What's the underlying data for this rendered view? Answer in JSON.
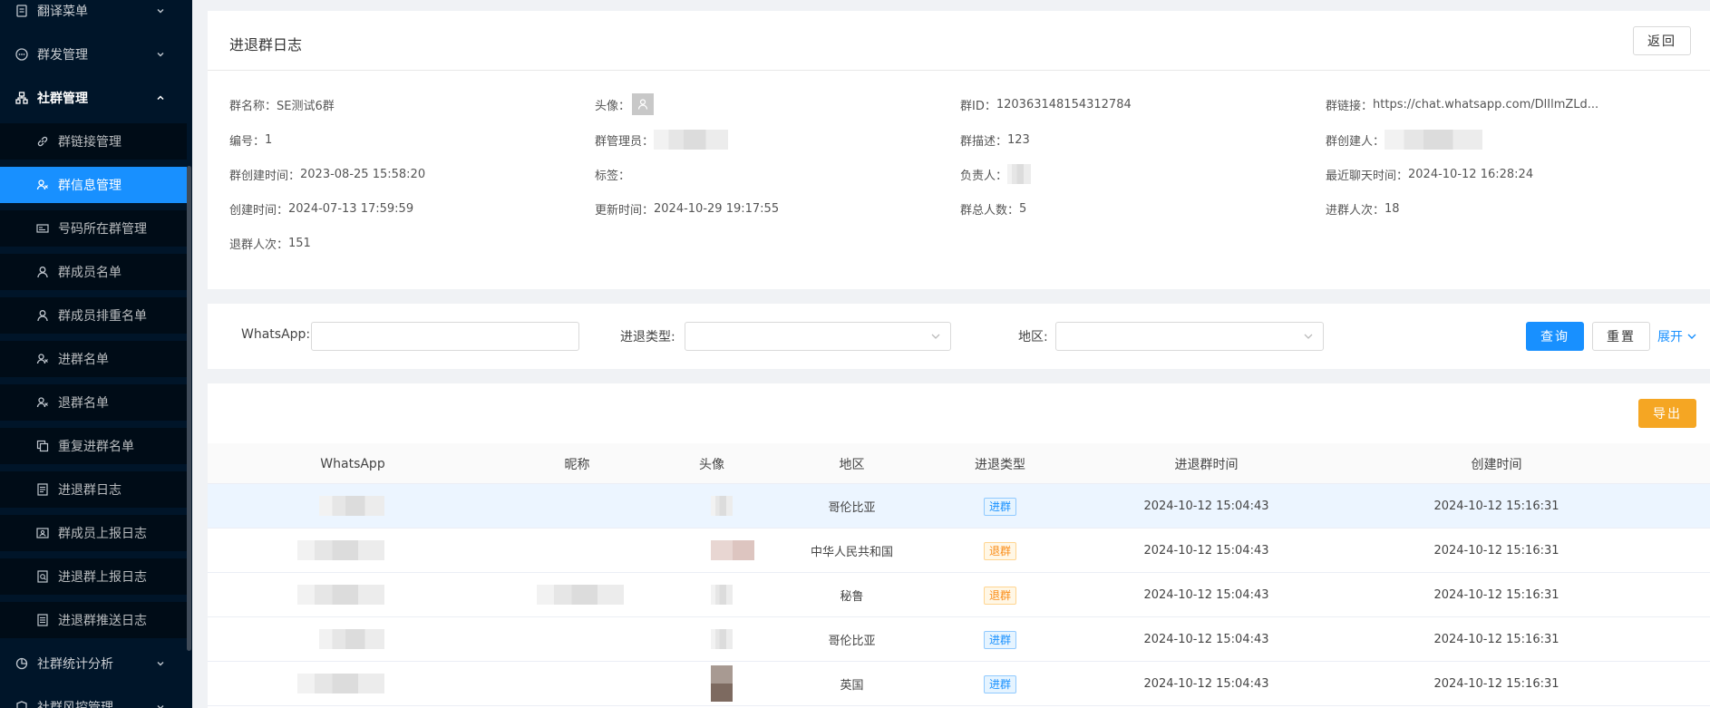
{
  "sidebar": {
    "groups": [
      {
        "label": "翻译菜单",
        "icon": "document-icon",
        "open": false
      },
      {
        "label": "群发管理",
        "icon": "chat-icon",
        "open": false
      },
      {
        "label": "社群管理",
        "icon": "org-icon",
        "open": true
      },
      {
        "label": "社群统计分析",
        "icon": "pie-chart-icon",
        "open": false
      },
      {
        "label": "社群风控管理",
        "icon": "shield-icon",
        "open": false
      }
    ],
    "sub_items": [
      {
        "label": "群链接管理",
        "icon": "link-icon"
      },
      {
        "label": "群信息管理",
        "icon": "users-icon",
        "active": true
      },
      {
        "label": "号码所在群管理",
        "icon": "card-icon"
      },
      {
        "label": "群成员名单",
        "icon": "user-icon"
      },
      {
        "label": "群成员排重名单",
        "icon": "user-icon"
      },
      {
        "label": "进群名单",
        "icon": "users-icon"
      },
      {
        "label": "退群名单",
        "icon": "users-icon"
      },
      {
        "label": "重复进群名单",
        "icon": "copy-icon"
      },
      {
        "label": "进退群日志",
        "icon": "file-icon"
      },
      {
        "label": "群成员上报日志",
        "icon": "id-card-icon"
      },
      {
        "label": "进退群上报日志",
        "icon": "file-check-icon"
      },
      {
        "label": "进退群推送日志",
        "icon": "list-icon"
      }
    ]
  },
  "info": {
    "title": "进退群日志",
    "back_label": "返回",
    "group_name_label": "群名称：",
    "group_name": "SE测试6群",
    "avatar_label": "头像：",
    "group_id_label": "群ID：",
    "group_id": "120363148154312784",
    "group_link_label": "群链接：",
    "group_link": "https://chat.whatsapp.com/DlIlmZLd...",
    "number_label": "编号：",
    "number": "1",
    "admin_label": "群管理员：",
    "desc_label": "群描述：",
    "desc": "123",
    "creator_label": "群创建人：",
    "create_time_label": "群创建时间：",
    "create_time": "2023-08-25 15:58:20",
    "tags_label": "标签：",
    "owner_label": "负责人：",
    "last_chat_label": "最近聊天时间：",
    "last_chat": "2024-10-12 16:28:24",
    "created_label": "创建时间：",
    "created": "2024-07-13 17:59:59",
    "updated_label": "更新时间：",
    "updated": "2024-10-29 19:17:55",
    "total_label": "群总人数：",
    "total": "5",
    "join_count_label": "进群人次：",
    "join_count": "18",
    "leave_count_label": "退群人次：",
    "leave_count": "151"
  },
  "search": {
    "whatsapp_label": "WhatsApp:",
    "whatsapp_value": "",
    "type_label": "进退类型:",
    "region_label": "地区:",
    "query_label": "查询",
    "reset_label": "重置",
    "expand_label": "展开"
  },
  "table": {
    "export_label": "导出",
    "columns": [
      "WhatsApp",
      "昵称",
      "头像",
      "地区",
      "进退类型",
      "进退群时间",
      "创建时间"
    ],
    "rows": [
      {
        "region": "哥伦比亚",
        "type": "进群",
        "type_kind": "in",
        "time": "2024-10-12 15:04:43",
        "created": "2024-10-12 15:16:31"
      },
      {
        "region": "中华人民共和国",
        "type": "退群",
        "type_kind": "out",
        "time": "2024-10-12 15:04:43",
        "created": "2024-10-12 15:16:31"
      },
      {
        "region": "秘鲁",
        "type": "退群",
        "type_kind": "out",
        "time": "2024-10-12 15:04:43",
        "created": "2024-10-12 15:16:31"
      },
      {
        "region": "哥伦比亚",
        "type": "进群",
        "type_kind": "in",
        "time": "2024-10-12 15:04:43",
        "created": "2024-10-12 15:16:31"
      },
      {
        "region": "英国",
        "type": "进群",
        "type_kind": "in",
        "time": "2024-10-12 15:04:43",
        "created": "2024-10-12 15:16:31"
      }
    ]
  },
  "colors": {
    "sidebar_bg": "#001529",
    "primary": "#1890ff",
    "export": "#f5a623"
  }
}
